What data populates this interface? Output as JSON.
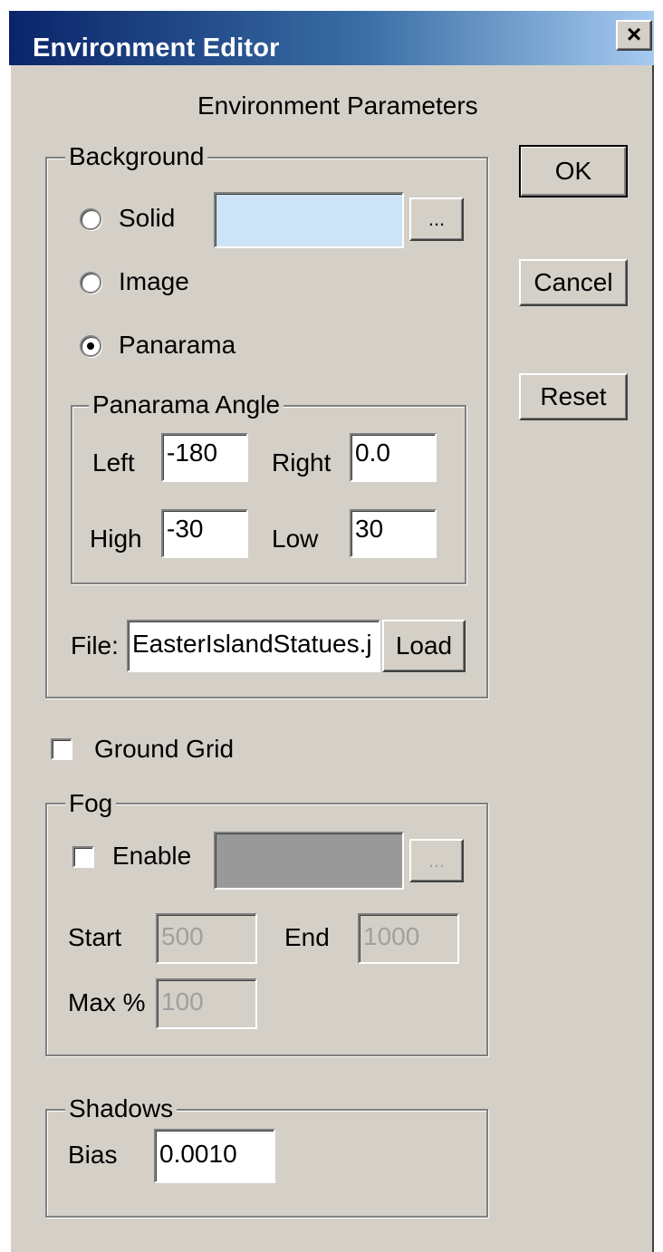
{
  "window": {
    "title": "Environment Editor",
    "close_glyph": "×",
    "close_icon": "close-icon"
  },
  "header": "Environment Parameters",
  "buttons": {
    "ok": "OK",
    "cancel": "Cancel",
    "reset": "Reset"
  },
  "background": {
    "legend": "Background",
    "solid_label": "Solid",
    "image_label": "Image",
    "panorama_label": "Panarama",
    "selected": "Panarama",
    "solid_color": "#cce4f6",
    "browse_label": "...",
    "panorama_angle": {
      "legend": "Panarama Angle",
      "left_label": "Left",
      "left_value": "-180",
      "right_label": "Right",
      "right_value": "0.0",
      "high_label": "High",
      "high_value": "-30",
      "low_label": "Low",
      "low_value": "30"
    },
    "file_label": "File:",
    "file_value": "EasterIslandStatues.j",
    "load_label": "Load"
  },
  "ground_grid": {
    "label": "Ground Grid",
    "checked": false
  },
  "fog": {
    "legend": "Fog",
    "enable_label": "Enable",
    "enabled": false,
    "color": "#999999",
    "browse_label": "...",
    "start_label": "Start",
    "start_value": "500",
    "end_label": "End",
    "end_value": "1000",
    "max_label": "Max %",
    "max_value": "100"
  },
  "shadows": {
    "legend": "Shadows",
    "bias_label": "Bias",
    "bias_value": "0.0010"
  }
}
